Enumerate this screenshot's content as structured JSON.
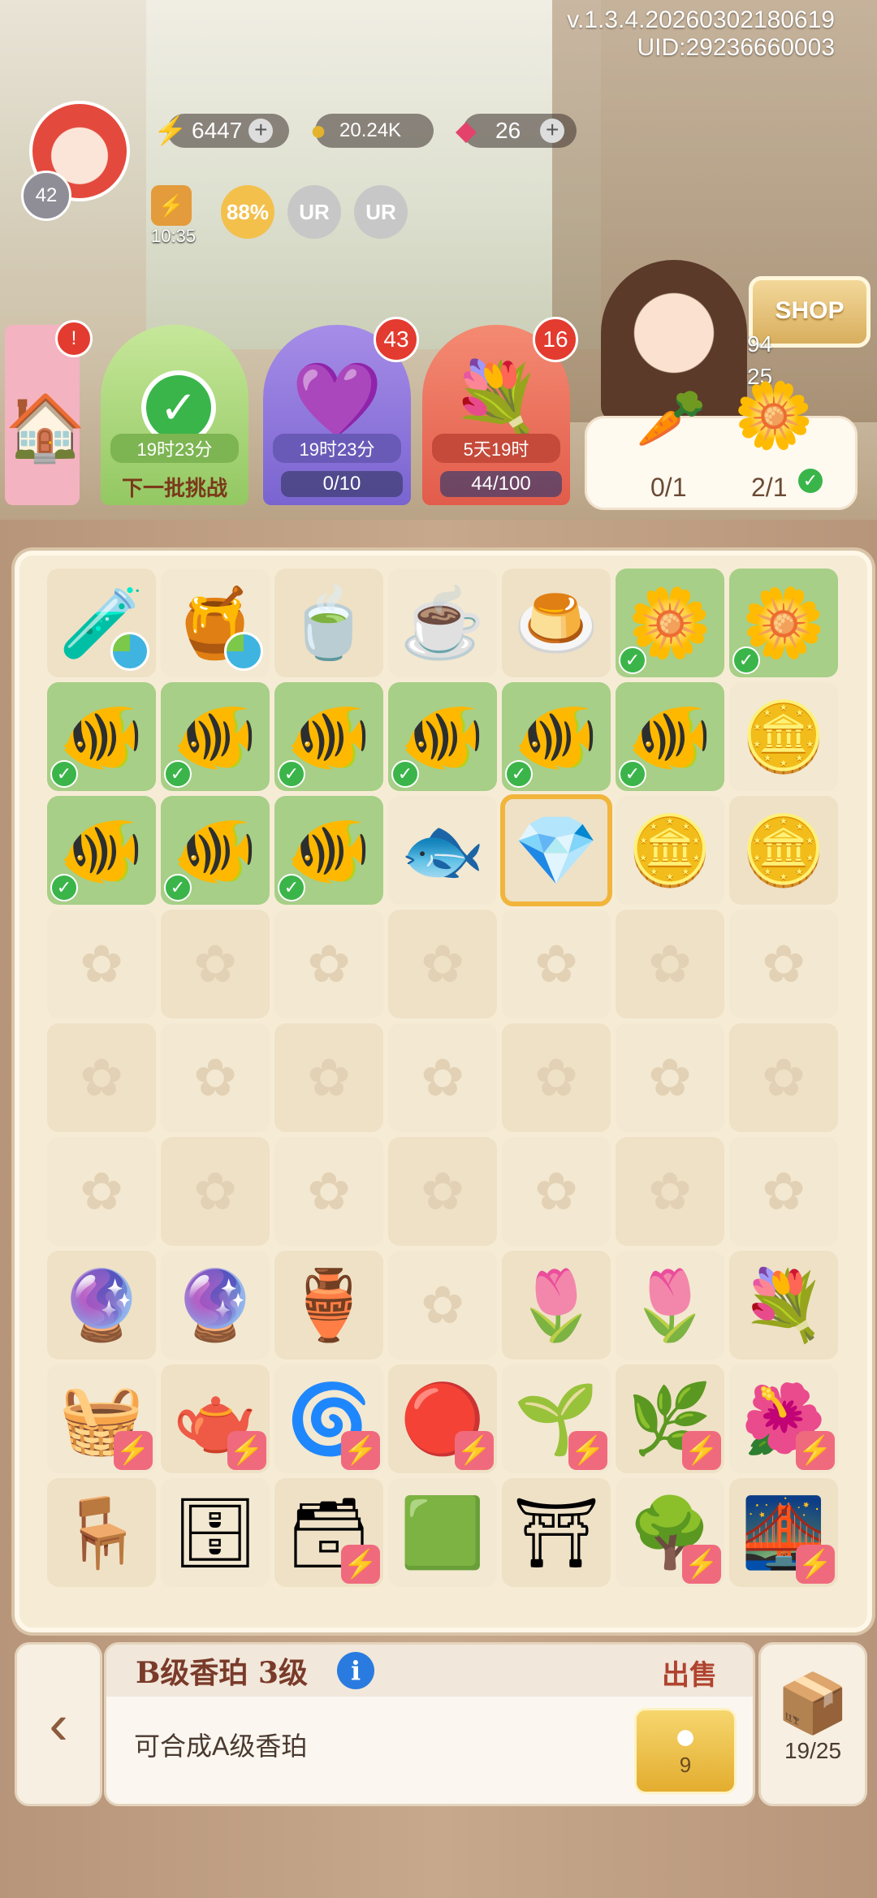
{
  "header": {
    "version": "v.1.3.4.20260302180619",
    "uid": "UID:29236660003",
    "avatar_level": "42"
  },
  "resources": {
    "energy": "6447",
    "coins": "20.24K",
    "gems": "26"
  },
  "boosts": {
    "energy_timer": "10:35",
    "up_percent": "88%",
    "ur1": "UR",
    "ur2": "UR"
  },
  "cards": [
    {
      "timer": "19时23分",
      "label": "下一批挑战"
    },
    {
      "timer": "19时23分",
      "progress": "0/10",
      "badge": "43"
    },
    {
      "timer": "5天19时",
      "progress": "44/100",
      "badge": "16"
    }
  ],
  "left_card_badge": "!",
  "shop": {
    "label": "SHOP",
    "stat1": "94",
    "stat2": "25"
  },
  "quest": {
    "item1_progress": "0/1",
    "item2_progress": "2/1"
  },
  "board_rows": [
    [
      "purple-potion",
      "gold-potion",
      "teacup",
      "cat-teacup",
      "cat-latte",
      "yellow-flowers",
      "yellow-flowers"
    ],
    [
      "clownfish",
      "clownfish",
      "clownfish",
      "clownfish",
      "clownfish",
      "clownfish",
      "coin-stack"
    ],
    [
      "clownfish",
      "clownfish",
      "clownfish",
      "red-fish",
      "blue-amber",
      "coin-pair",
      "coin-single"
    ],
    [
      "empty",
      "empty",
      "empty",
      "empty",
      "empty",
      "empty",
      "empty"
    ],
    [
      "empty",
      "empty",
      "empty",
      "empty",
      "empty",
      "empty",
      "empty"
    ],
    [
      "empty",
      "empty",
      "empty",
      "empty",
      "empty",
      "empty",
      "empty"
    ],
    [
      "blue-plant-jar",
      "blue-plant-jar",
      "flower-jar",
      "empty",
      "calla-lily",
      "calla-lily-pair",
      "calla-bouquet"
    ],
    [
      "basket",
      "teapot",
      "purple-vortex",
      "red-vortex",
      "sprout-bed",
      "bud-bed",
      "flower-bed"
    ],
    [
      "small-table",
      "desk",
      "cabinet",
      "tile-plot",
      "garden-arch",
      "garden-gate",
      "garden-bridge"
    ]
  ],
  "selected": {
    "title": "B级香珀 3级",
    "info_icon": "i",
    "sell_label": "出售",
    "description": "可合成A级香珀",
    "sell_price": "9"
  },
  "inventory": {
    "count": "19/25"
  }
}
